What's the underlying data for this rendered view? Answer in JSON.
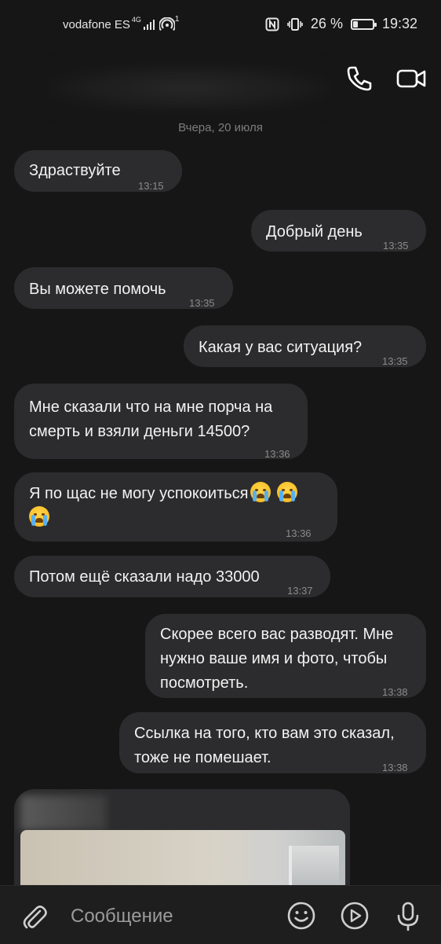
{
  "status_bar": {
    "carrier": "vodafone ES",
    "network": "4G",
    "hotspot_count": "1",
    "battery_percent": "26 %",
    "battery_level": 0.26,
    "time": "19:32"
  },
  "header": {
    "call_icon": "phone-icon",
    "video_icon": "video-camera-icon"
  },
  "date_separator": "Вчера, 20 июля",
  "messages": [
    {
      "side": "in",
      "text": "Здраствуйте",
      "time": "13:15"
    },
    {
      "side": "out",
      "text": "Добрый день",
      "time": "13:35"
    },
    {
      "side": "in",
      "text": "Вы можете помочь",
      "time": "13:35"
    },
    {
      "side": "out",
      "text": "Какая у вас ситуация?",
      "time": "13:35"
    },
    {
      "side": "in",
      "line1": "Мне сказали что на мне порча на",
      "line2": "смерть и взяли деньги 14500?",
      "time": "13:36"
    },
    {
      "side": "in",
      "text": "Я по щас не могу успокоиться",
      "emoji": "😭",
      "time": "13:36"
    },
    {
      "side": "in",
      "text": "Потом ещё сказали надо 33000",
      "time": "13:37"
    },
    {
      "side": "out",
      "line1": "Скорее всего вас разводят. Мне",
      "line2": "нужно ваше имя и фото, чтобы",
      "line3": "посмотреть.",
      "time": "13:38"
    },
    {
      "side": "out",
      "line1": "Ссылка на того, кто вам это сказал,",
      "line2": "тоже не помешает.",
      "time": "13:38"
    }
  ],
  "composer": {
    "placeholder": "Сообщение",
    "attach_icon": "paperclip-icon",
    "emoji_icon": "smiley-icon",
    "video_note_icon": "play-circle-icon",
    "voice_icon": "microphone-icon"
  },
  "colors": {
    "background": "#161616",
    "bubble": "#2c2c2e",
    "text": "#f2f2f2",
    "meta": "#8a8a8a"
  }
}
